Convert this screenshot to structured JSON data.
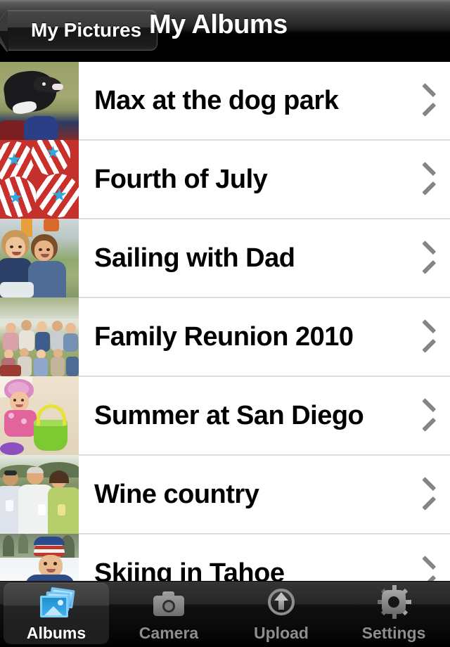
{
  "navbar": {
    "back_label": "My Pictures",
    "title": "My Albums"
  },
  "list": {
    "rows": [
      {
        "title": "Max at the dog park",
        "chevron": "chevron-right-icon",
        "thumb": "dog-on-grass-photo"
      },
      {
        "title": "Fourth of July",
        "chevron": "chevron-right-icon",
        "thumb": "flag-cupcakes-photo"
      },
      {
        "title": "Sailing with Dad",
        "chevron": "chevron-right-icon",
        "thumb": "two-boys-photo"
      },
      {
        "title": "Family Reunion 2010",
        "chevron": "chevron-right-icon",
        "thumb": "family-group-photo"
      },
      {
        "title": "Summer at San Diego",
        "chevron": "chevron-right-icon",
        "thumb": "girl-on-beach-photo"
      },
      {
        "title": "Wine country",
        "chevron": "chevron-right-icon",
        "thumb": "three-adults-photo"
      },
      {
        "title": "Skiing in Tahoe",
        "chevron": "chevron-right-icon",
        "thumb": "child-in-snow-photo"
      }
    ]
  },
  "tabbar": {
    "tabs": [
      {
        "label": "Albums",
        "icon": "albums-icon",
        "active": true
      },
      {
        "label": "Camera",
        "icon": "camera-icon",
        "active": false
      },
      {
        "label": "Upload",
        "icon": "upload-icon",
        "active": false
      },
      {
        "label": "Settings",
        "icon": "gear-icon",
        "active": false
      }
    ]
  },
  "colors": {
    "accent_blue": "#4aa8e0",
    "separator": "#dcdcdc",
    "chevron_gray": "#858585",
    "tab_label_gray": "#8e8e8e",
    "tab_label_active": "#ffffff",
    "bar_black": "#000000",
    "list_background": "#ffffff"
  }
}
